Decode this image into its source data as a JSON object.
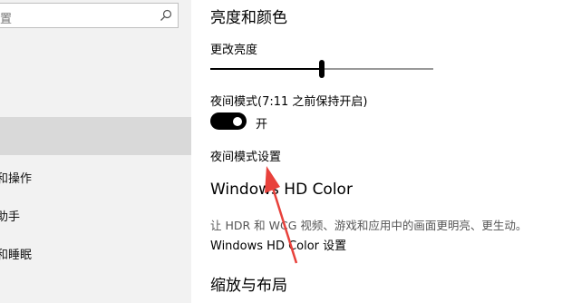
{
  "sidebar": {
    "search_placeholder": "置",
    "items": [
      {
        "label": "和操作"
      },
      {
        "label": "助手"
      },
      {
        "label": "和睡眠"
      }
    ]
  },
  "main": {
    "section_title": "亮度和颜色",
    "brightness_label": "更改亮度",
    "brightness_value": 0.5,
    "night_mode_label": "夜间模式(7:11 之前保持开启)",
    "night_mode_state": "开",
    "night_mode_on": true,
    "night_mode_settings_link": "夜间模式设置",
    "hdr_title": "Windows HD Color",
    "hdr_description": "让 HDR 和 WCG 视频、游戏和应用中的画面更明亮、更生动。",
    "hdr_settings_link": "Windows HD Color 设置",
    "scale_title": "缩放与布局"
  },
  "colors": {
    "accent": "#000000",
    "annotation_arrow": "#e8413b"
  }
}
